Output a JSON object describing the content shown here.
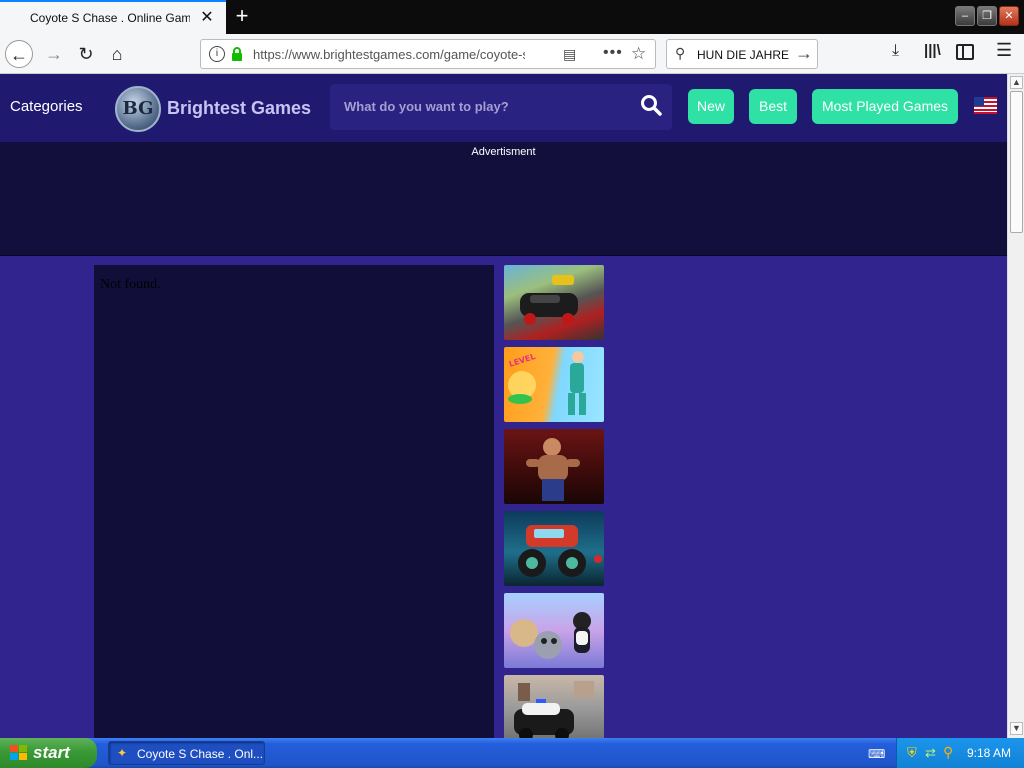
{
  "browser": {
    "tab_title": "Coyote S Chase . Online Games . Brightest Games",
    "tab_close": "✕",
    "new_tab": "+",
    "url": "https://www.brightestgames.com/game/coyote-s-chase",
    "search_text": "HUN DIE JAHRE"
  },
  "site": {
    "categories_label": "Categories",
    "logo_mark": "BG",
    "logo_text": "Brightest Games",
    "search_placeholder": "What do you want to play?",
    "nav_buttons": {
      "new": "New",
      "best": "Best",
      "most_played": "Most Played Games"
    },
    "ad_label": "Advertisment",
    "game_message": "Not found.",
    "thumbnails": [
      "game-thumbnail",
      "game-thumbnail",
      "game-thumbnail",
      "game-thumbnail",
      "game-thumbnail",
      "game-thumbnail"
    ]
  },
  "taskbar": {
    "start_label": "start",
    "task_label": "Coyote S Chase . Onl...",
    "clock": "9:18 AM"
  },
  "colors": {
    "page_bg": "#32248f",
    "header_bg": "#1f1970",
    "accent_button": "#2fe1a5",
    "logo_text": "#c7c4f2"
  }
}
